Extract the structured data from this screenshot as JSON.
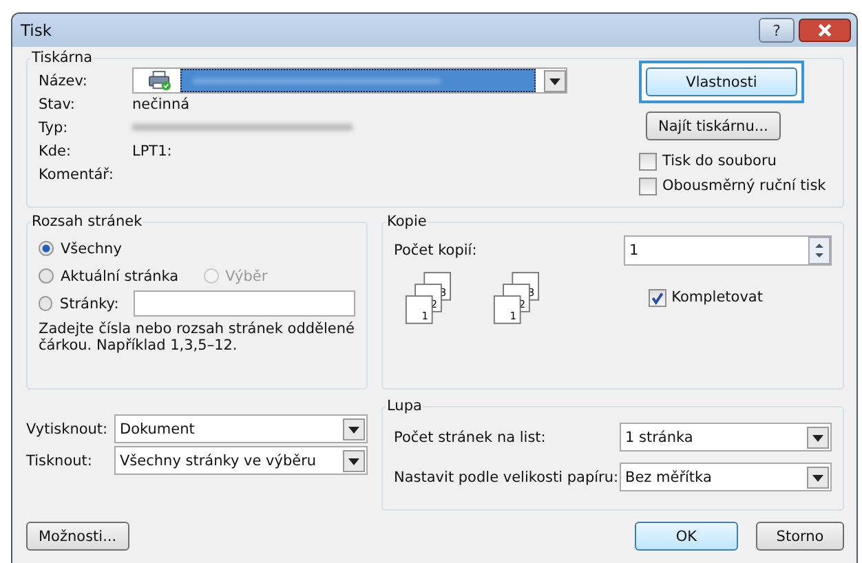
{
  "window": {
    "title": "Tisk",
    "help_button": "?"
  },
  "printer": {
    "legend": "Tiskárna",
    "fields": [
      {
        "kind": "select",
        "label": "Název:"
      },
      {
        "kind": "text",
        "label": "Stav:",
        "value": "nečinná"
      },
      {
        "kind": "blurred",
        "label": "Typ:"
      },
      {
        "kind": "text",
        "label": "Kde:",
        "value": "LPT1:"
      },
      {
        "kind": "text",
        "label": "Komentář:"
      }
    ],
    "buttons": [
      {
        "label": "Vlastnosti",
        "focused": true
      },
      {
        "label": "Najít tiskárnu...",
        "focused": false
      }
    ],
    "checkboxes": [
      {
        "label": "Tisk do souboru",
        "checked": false
      },
      {
        "label": "Obousměrný ruční tisk",
        "checked": false
      }
    ]
  },
  "page_range": {
    "legend": "Rozsah stránek",
    "options": [
      {
        "label": "Všechny",
        "selected": true,
        "disabled": false
      },
      {
        "label": "Aktuální stránka",
        "selected": false,
        "disabled": false
      },
      {
        "label": "Výběr",
        "selected": false,
        "disabled": true
      },
      {
        "label": "Stránky:",
        "selected": false,
        "disabled": false
      }
    ],
    "hint": "Zadejte čísla nebo rozsah stránek oddělené čárkou. Například 1,3,5–12."
  },
  "copies": {
    "legend": "Kopie",
    "label": "Počet kopií:",
    "value": "1",
    "stacks": [
      [
        "1",
        "2",
        "3"
      ],
      [
        "1",
        "2",
        "3"
      ]
    ],
    "collate": {
      "label": "Kompletovat",
      "checked": true
    }
  },
  "print_what": [
    {
      "label": "Vytisknout:",
      "value": "Dokument"
    },
    {
      "label": "Tisknout:",
      "value": "Všechny stránky ve výběru"
    }
  ],
  "zoom": {
    "legend": "Lupa",
    "rows": [
      {
        "label": "Počet stránek na list:",
        "value": "1 stránka"
      },
      {
        "label": "Nastavit podle velikosti papíru:",
        "value": "Bez měřítka"
      }
    ]
  },
  "buttons": [
    {
      "label": "Možnosti...",
      "default": false
    },
    {
      "label": "OK",
      "default": true
    },
    {
      "label": "Storno",
      "default": false
    }
  ]
}
